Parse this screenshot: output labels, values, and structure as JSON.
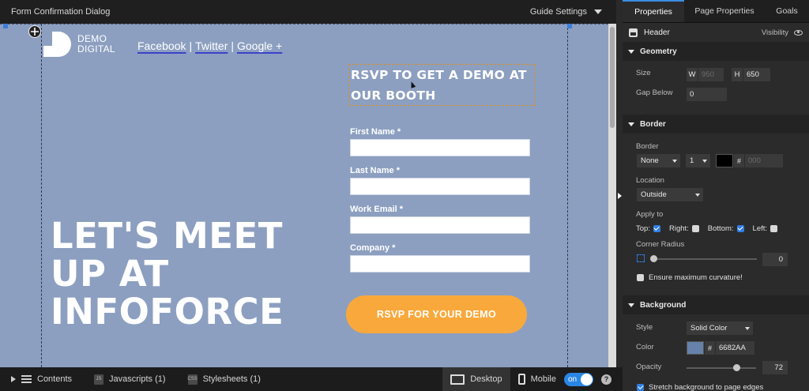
{
  "window": {
    "title": "Form Confirmation Dialog",
    "guide_settings": "Guide Settings"
  },
  "canvas": {
    "logo": {
      "line1": "DEMO",
      "line2": "DIGITAL"
    },
    "social": {
      "facebook": "Facebook",
      "twitter": "Twitter",
      "google": "Google +",
      "separator": "|"
    },
    "headline": {
      "line1": "LET'S MEET",
      "line2": "UP AT",
      "line3": "INFOFORCE"
    },
    "rsvp_heading": "RSVP TO GET A DEMO AT OUR BOOTH",
    "form": {
      "first_name_label": "First Name *",
      "last_name_label": "Last Name *",
      "work_email_label": "Work Email *",
      "company_label": "Company *"
    },
    "cta_label": "RSVP FOR YOUR DEMO",
    "colors": {
      "background": "#8c9fc0",
      "cta": "#f9a93c",
      "link_underline": "#3b42c8"
    }
  },
  "bottom_bar": {
    "contents": "Contents",
    "javascripts": "Javascripts (1)",
    "stylesheets": "Stylesheets (1)",
    "desktop": "Desktop",
    "mobile": "Mobile",
    "mobile_toggle": "on",
    "help": "?"
  },
  "panel": {
    "tabs": [
      "Properties",
      "Page Properties",
      "Goals"
    ],
    "element": {
      "name": "Header",
      "visibility": "Visibility"
    },
    "geometry": {
      "title": "Geometry",
      "size_label": "Size",
      "w_label": "W",
      "w_value": "950",
      "h_label": "H",
      "h_value": "650",
      "gap_label": "Gap Below",
      "gap_value": "0"
    },
    "border": {
      "title": "Border",
      "border_label": "Border",
      "style_value": "None",
      "width_value": "1",
      "hash": "#",
      "color_value": "000",
      "location_label": "Location",
      "location_value": "Outside",
      "apply_label": "Apply to",
      "top": "Top:",
      "right": "Right:",
      "bottom": "Bottom:",
      "left": "Left:",
      "radius_label": "Corner Radius",
      "radius_value": "0",
      "curvature_label": "Ensure maximum curvature!"
    },
    "background": {
      "title": "Background",
      "style_label": "Style",
      "style_value": "Solid Color",
      "color_label": "Color",
      "hash": "#",
      "color_value": "6682AA",
      "swatch": "#6682AA",
      "opacity_label": "Opacity",
      "opacity_value": "72",
      "stretch_label": "Stretch background to page edges"
    }
  }
}
